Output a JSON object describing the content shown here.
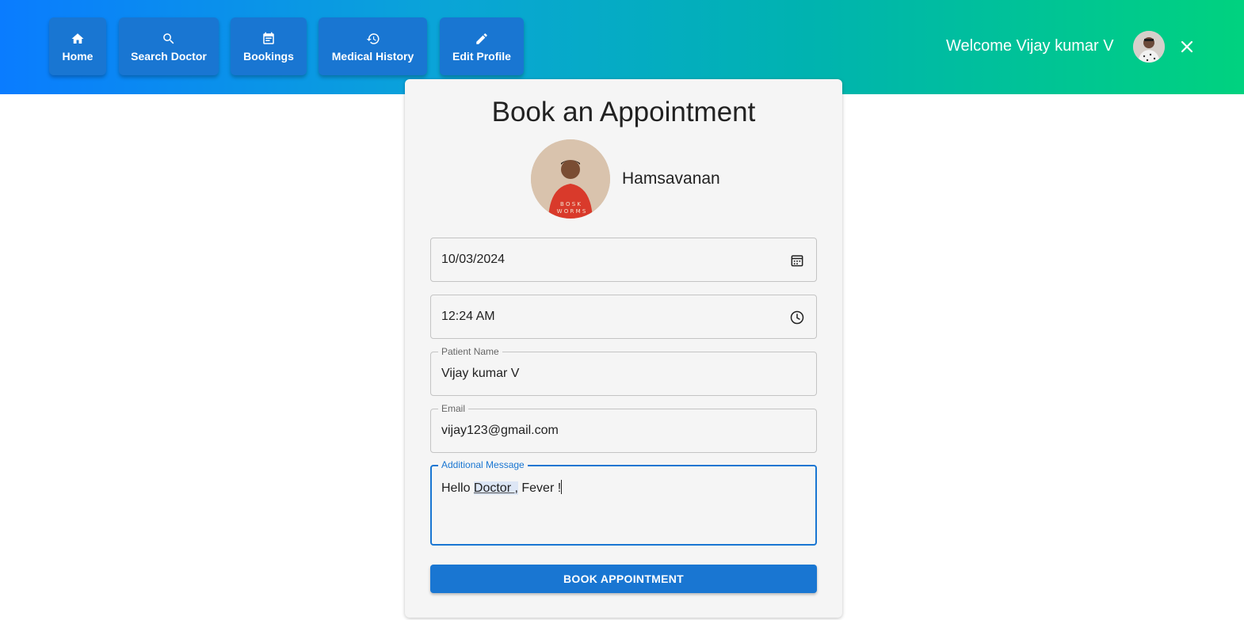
{
  "nav": {
    "items": [
      {
        "label": "Home",
        "icon": "home-icon"
      },
      {
        "label": "Search Doctor",
        "icon": "search-icon"
      },
      {
        "label": "Bookings",
        "icon": "calendar-icon"
      },
      {
        "label": "Medical History",
        "icon": "history-icon"
      },
      {
        "label": "Edit Profile",
        "icon": "pencil-icon"
      }
    ],
    "welcome": "Welcome Vijay kumar V"
  },
  "form": {
    "title": "Book an Appointment",
    "doctor_name": "Hamsavanan",
    "date_value": "10/03/2024",
    "time_value": "12:24 AM",
    "patient_label": "Patient Name",
    "patient_value": "Vijay kumar V",
    "email_label": "Email",
    "email_value": "vijay123@gmail.com",
    "message_label": "Additional Message",
    "message_part1": "Hello ",
    "message_part2": "Doctor ,",
    "message_part3": " Fever !",
    "submit_label": "BOOK APPOINTMENT"
  },
  "colors": {
    "primary": "#1976d2",
    "gradient_start": "#0a7cff",
    "gradient_end": "#00d27f"
  }
}
